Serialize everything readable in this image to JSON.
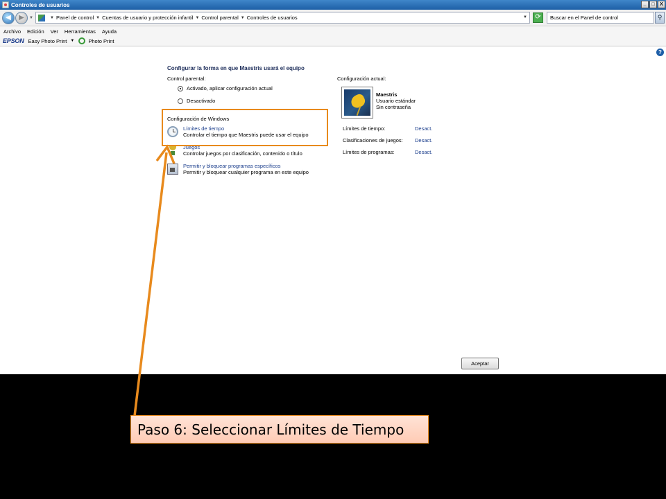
{
  "window": {
    "title": "Controles de usuarios",
    "controls": {
      "minimize": "_",
      "maximize": "□",
      "close": "X"
    }
  },
  "address": {
    "breadcrumbs": [
      "Panel de control",
      "Cuentas de usuario y protección infantil",
      "Control parental",
      "Controles de usuarios"
    ],
    "search_placeholder": "Buscar en el Panel de control"
  },
  "menu": [
    "Archivo",
    "Edición",
    "Ver",
    "Herramientas",
    "Ayuda"
  ],
  "epson_bar": {
    "logo": "EPSON",
    "easy_photo_print": "Easy Photo Print",
    "photo_print": "Photo Print"
  },
  "main": {
    "title": "Configurar la forma en que Maestris usará el equipo",
    "parental_label": "Control parental:",
    "radio_on": "Activado, aplicar configuración actual",
    "radio_off": "Desactivado",
    "windows_settings_label": "Configuración de Windows",
    "links": [
      {
        "title": "Límites de tiempo",
        "desc": "Controlar el tiempo que Maestris puede usar el equipo"
      },
      {
        "title": "Juegos",
        "desc": "Controlar juegos por clasificación, contenido o título"
      },
      {
        "title": "Permitir y bloquear programas específicos",
        "desc": "Permitir y bloquear cualquier programa en este equipo"
      }
    ]
  },
  "current": {
    "label": "Configuración actual:",
    "user_name": "Maestris",
    "user_type": "Usuario estándar",
    "user_password": "Sin contraseña",
    "stats": [
      {
        "label": "Límites de tiempo:",
        "value": "Desact."
      },
      {
        "label": "Clasificaciones de juegos:",
        "value": "Desact."
      },
      {
        "label": "Límites de programas:",
        "value": "Desact."
      }
    ]
  },
  "accept_label": "Aceptar",
  "annotation": {
    "text": "Paso 6:  Seleccionar Límites de Tiempo",
    "color": "#e88a1d"
  }
}
